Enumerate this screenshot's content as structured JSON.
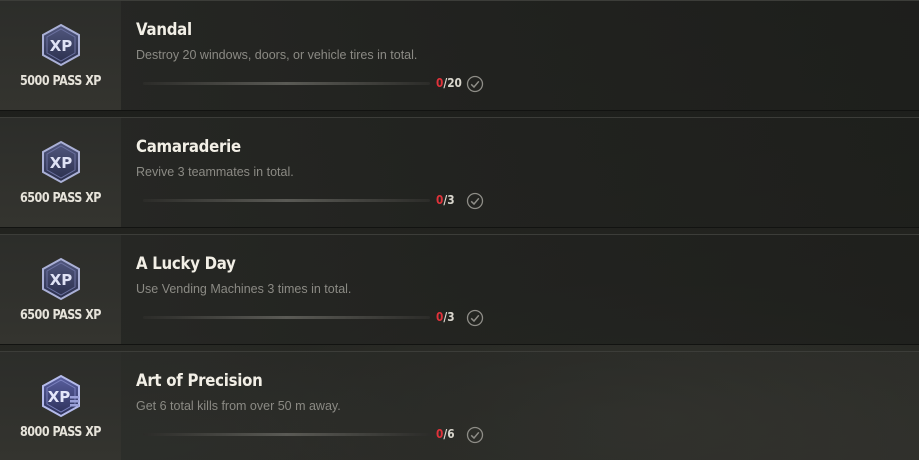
{
  "missions": [
    {
      "reward": "5000 PASS XP",
      "badge_text": "XP",
      "title": "Vandal",
      "description": "Destroy 20 windows, doors, or vehicle tires in total.",
      "current": "0",
      "total": "/20",
      "progress": 0,
      "status_icon": "checkmark-circle-icon"
    },
    {
      "reward": "6500 PASS XP",
      "badge_text": "XP",
      "title": "Camaraderie",
      "description": "Revive 3 teammates in total.",
      "current": "0",
      "total": "/3",
      "progress": 0,
      "status_icon": "checkmark-circle-icon"
    },
    {
      "reward": "6500 PASS XP",
      "badge_text": "XP",
      "title": "A Lucky Day",
      "description": "Use Vending Machines 3 times in total.",
      "current": "0",
      "total": "/3",
      "progress": 0,
      "status_icon": "checkmark-circle-icon"
    },
    {
      "reward": "8000 PASS XP",
      "badge_text": "XP",
      "title": "Art of Precision",
      "description": "Get 6 total kills from over 50 m away.",
      "current": "0",
      "total": "/6",
      "progress": 0,
      "status_icon": "checkmark-circle-icon"
    }
  ],
  "colors": {
    "current_count": "#e0323a",
    "badge_fill": "#3a3f63",
    "badge_border": "#9aa0c8"
  }
}
